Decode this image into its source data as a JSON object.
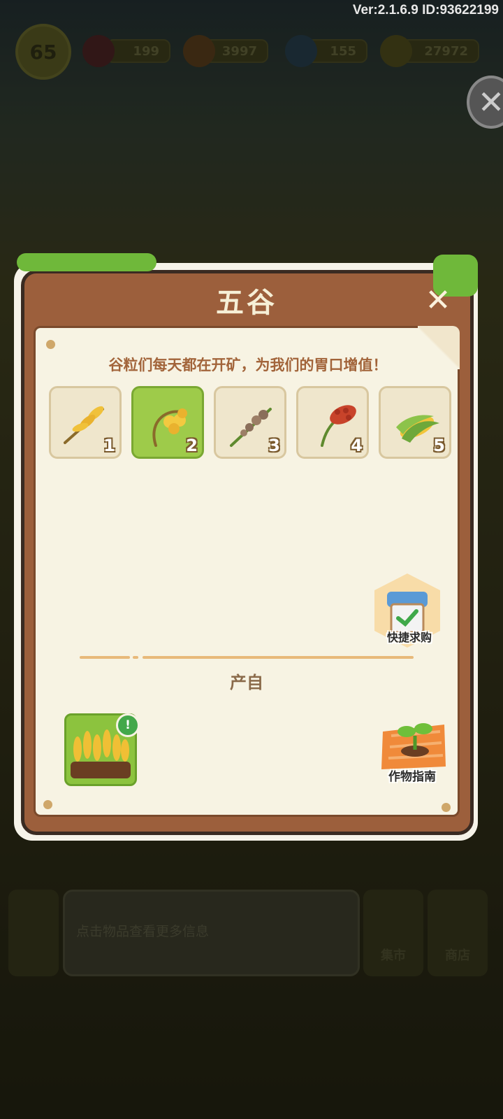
{
  "version": "Ver:2.1.6.9 ID:93622199",
  "hud": {
    "level": "65",
    "gems": "199",
    "carrots": "3997",
    "energy": "155",
    "coins": "27972"
  },
  "bottom": {
    "hint": "点击物品查看更多信息",
    "market": "集市",
    "shop": "商店"
  },
  "panel": {
    "title": "五谷",
    "close": "✕",
    "description": "谷粒们每天都在开矿，为我们的胃口增值！",
    "items": [
      {
        "num": "1",
        "icon": "wheat-icon"
      },
      {
        "num": "2",
        "icon": "barley-icon"
      },
      {
        "num": "3",
        "icon": "buckwheat-icon"
      },
      {
        "num": "4",
        "icon": "sorghum-icon"
      },
      {
        "num": "5",
        "icon": "corn-icon"
      }
    ],
    "selected_index": 2,
    "quick_buy": "快捷求购",
    "produce_heading": "产自",
    "produce_badge": "!",
    "crop_guide": "作物指南"
  },
  "colors": {
    "panel_wood": "#9c5f3c",
    "paper": "#f7f3e3",
    "selected_green": "#9ecb4a"
  }
}
